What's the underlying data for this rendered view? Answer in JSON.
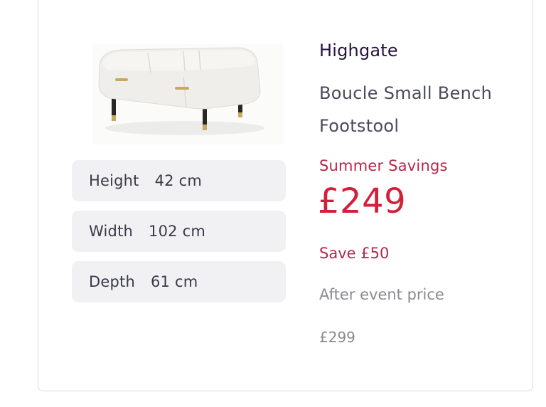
{
  "product": {
    "brand": "Highgate",
    "name": "Boucle Small Bench Footstool",
    "image_alt": "white boucle bench footstool"
  },
  "dimensions": [
    {
      "label": "Height",
      "value": "42 cm"
    },
    {
      "label": "Width",
      "value": "102 cm"
    },
    {
      "label": "Depth",
      "value": "61 cm"
    }
  ],
  "pricing": {
    "promo_label": "Summer Savings",
    "price": "£249",
    "saving": "Save £50",
    "after_event_label": "After event price",
    "after_event_price": "£299"
  },
  "colors": {
    "price": "#d41f3a",
    "promo": "#b8264a",
    "brand": "#2a1440"
  }
}
